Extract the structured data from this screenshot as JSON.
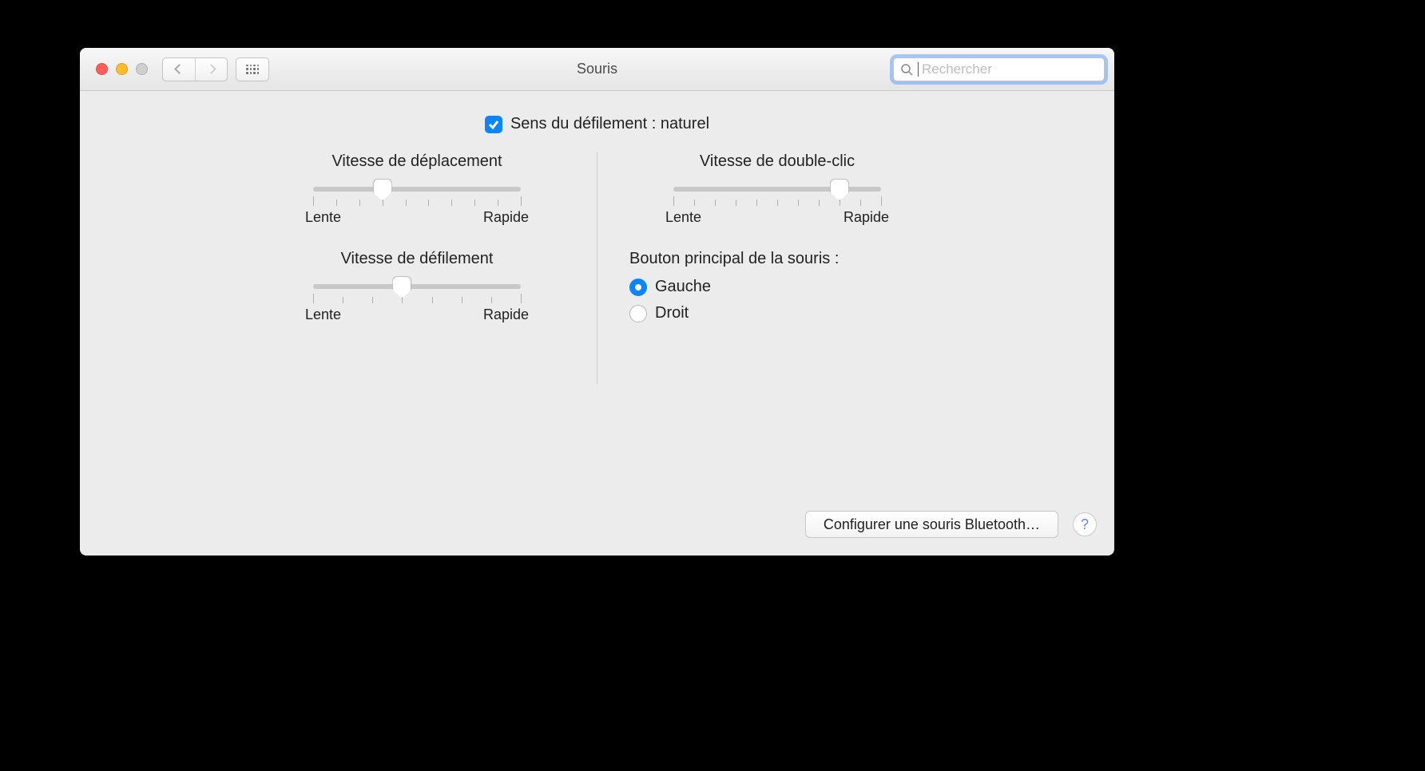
{
  "window": {
    "title": "Souris"
  },
  "search": {
    "placeholder": "Rechercher"
  },
  "scrollDirection": {
    "label": "Sens du défilement : naturel",
    "checked": true
  },
  "sliders": {
    "tracking": {
      "title": "Vitesse de déplacement",
      "min_label": "Lente",
      "max_label": "Rapide",
      "ticks": 10,
      "value": 3
    },
    "scrolling": {
      "title": "Vitesse de défilement",
      "min_label": "Lente",
      "max_label": "Rapide",
      "ticks": 8,
      "value": 3
    },
    "doubleclick": {
      "title": "Vitesse de double-clic",
      "min_label": "Lente",
      "max_label": "Rapide",
      "ticks": 11,
      "value": 8
    }
  },
  "primaryButton": {
    "title": "Bouton principal de la souris :",
    "left": {
      "label": "Gauche",
      "checked": true
    },
    "right": {
      "label": "Droit",
      "checked": false
    }
  },
  "footer": {
    "configure_bt": "Configurer une souris Bluetooth…",
    "help": "?"
  }
}
